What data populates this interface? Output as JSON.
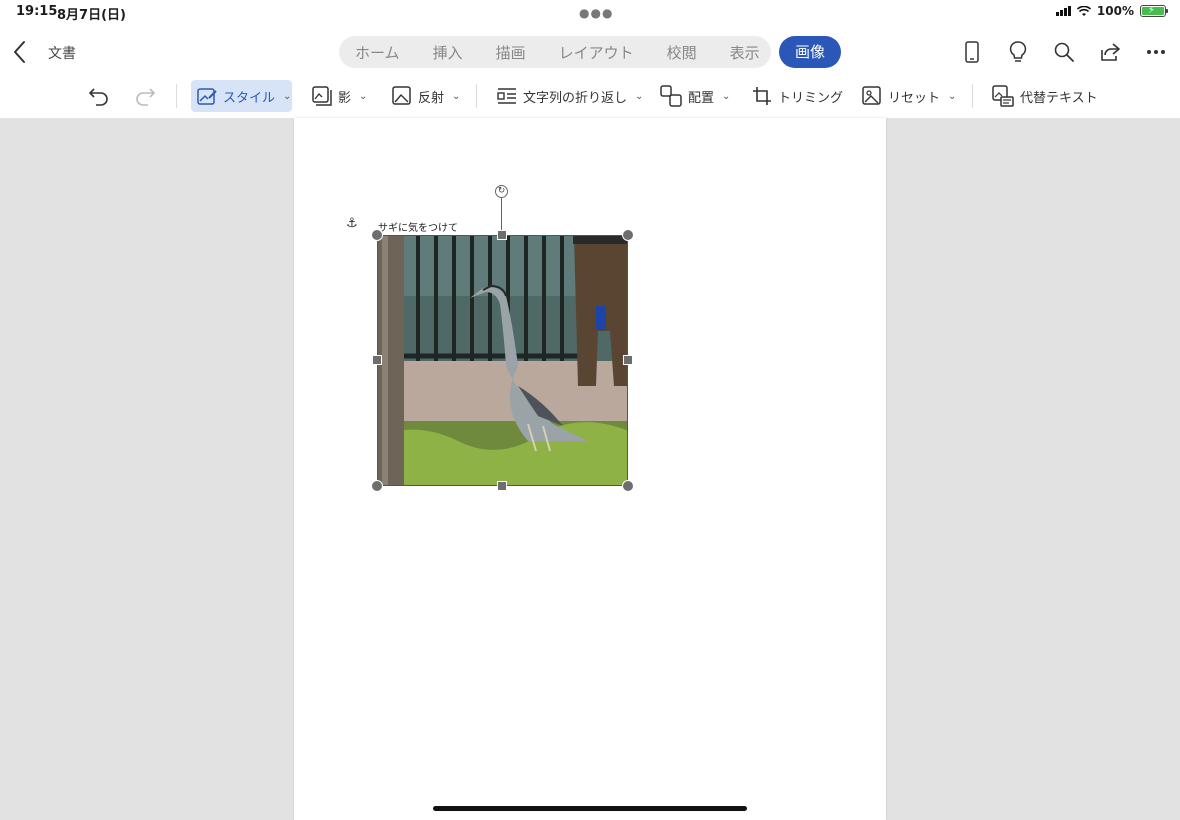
{
  "status": {
    "time": "19:15",
    "date": "8月7日(日)",
    "battery": "100%"
  },
  "header": {
    "doc_name": "文書",
    "tabs": [
      "ホーム",
      "挿入",
      "描画",
      "レイアウト",
      "校閲",
      "表示"
    ],
    "active_tab": "画像"
  },
  "toolbar": {
    "style": "スタイル",
    "shadow": "影",
    "reflection": "反射",
    "wrap": "文字列の折り返し",
    "arrange": "配置",
    "crop": "トリミング",
    "reset": "リセット",
    "alt_text": "代替テキスト"
  },
  "document": {
    "caption": "サギに気をつけて"
  },
  "colors": {
    "accent": "#2b58b8",
    "selected_bg": "#d7e4f7",
    "canvas": "#e2e2e2"
  }
}
